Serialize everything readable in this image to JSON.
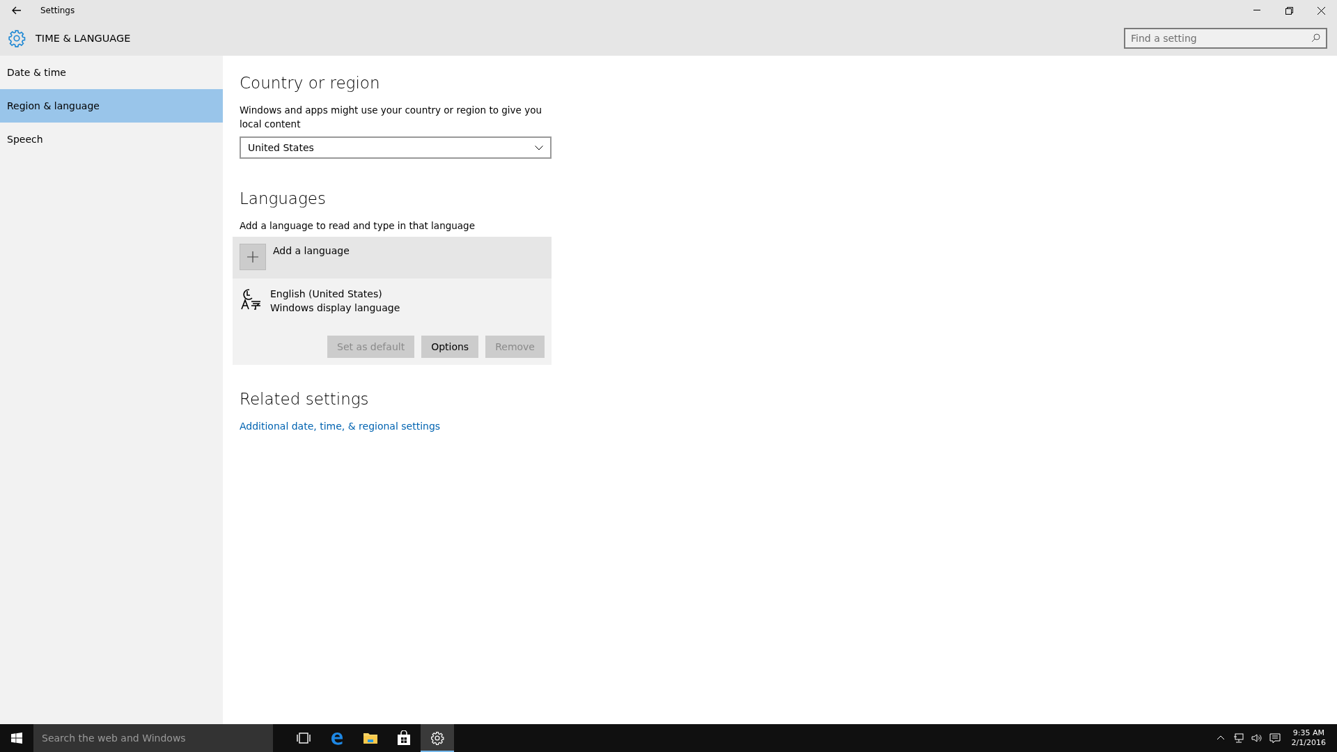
{
  "window": {
    "title": "Settings"
  },
  "header": {
    "title": "TIME & LANGUAGE",
    "search": {
      "placeholder": "Find a setting"
    }
  },
  "sidebar": {
    "items": [
      {
        "label": "Date & time",
        "selected": false
      },
      {
        "label": "Region & language",
        "selected": true
      },
      {
        "label": "Speech",
        "selected": false
      }
    ]
  },
  "country_section": {
    "heading": "Country or region",
    "description": "Windows and apps might use your country or region to give you local content",
    "dropdown": {
      "value": "United States"
    }
  },
  "languages_section": {
    "heading": "Languages",
    "description": "Add a language to read and type in that language",
    "add_button": {
      "label": "Add a language"
    },
    "languages": [
      {
        "name": "English (United States)",
        "detail": "Windows display language"
      }
    ],
    "buttons": [
      {
        "label": "Set as default",
        "disabled": true
      },
      {
        "label": "Options",
        "disabled": false
      },
      {
        "label": "Remove",
        "disabled": true
      }
    ]
  },
  "related_section": {
    "heading": "Related settings",
    "links": [
      "Additional date, time, & regional settings"
    ]
  },
  "taskbar": {
    "search": {
      "placeholder": "Search the web and Windows"
    },
    "apps": [
      {
        "kind": "taskview",
        "selected": false
      },
      {
        "kind": "edge",
        "selected": false
      },
      {
        "kind": "explorer",
        "selected": false
      },
      {
        "kind": "store",
        "selected": false
      },
      {
        "kind": "settings",
        "selected": true
      }
    ],
    "clock": {
      "time": "9:35 AM",
      "date": "2/1/2016"
    }
  }
}
